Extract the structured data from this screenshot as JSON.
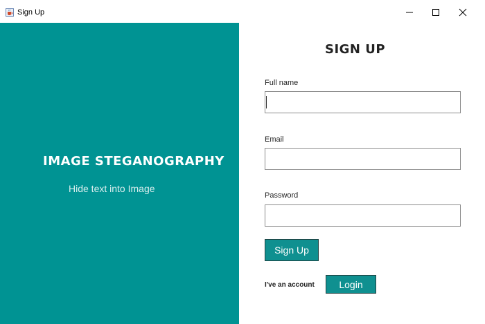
{
  "window": {
    "title": "Sign Up",
    "icon": "java-cup-icon",
    "controls": [
      "minimize-icon",
      "maximize-icon",
      "close-icon"
    ]
  },
  "brand": {
    "title": "IMAGE STEGANOGRAPHY",
    "subtitle": "Hide text into Image",
    "panel_color": "#009393"
  },
  "form": {
    "title": "SIGN UP",
    "full_name": {
      "label": "Full name",
      "value": ""
    },
    "email": {
      "label": "Email",
      "value": ""
    },
    "password": {
      "label": "Password",
      "value": ""
    },
    "signup_label": "Sign Up",
    "account_text": "I've an account",
    "login_label": "Login",
    "button_color": "#0f9090"
  }
}
